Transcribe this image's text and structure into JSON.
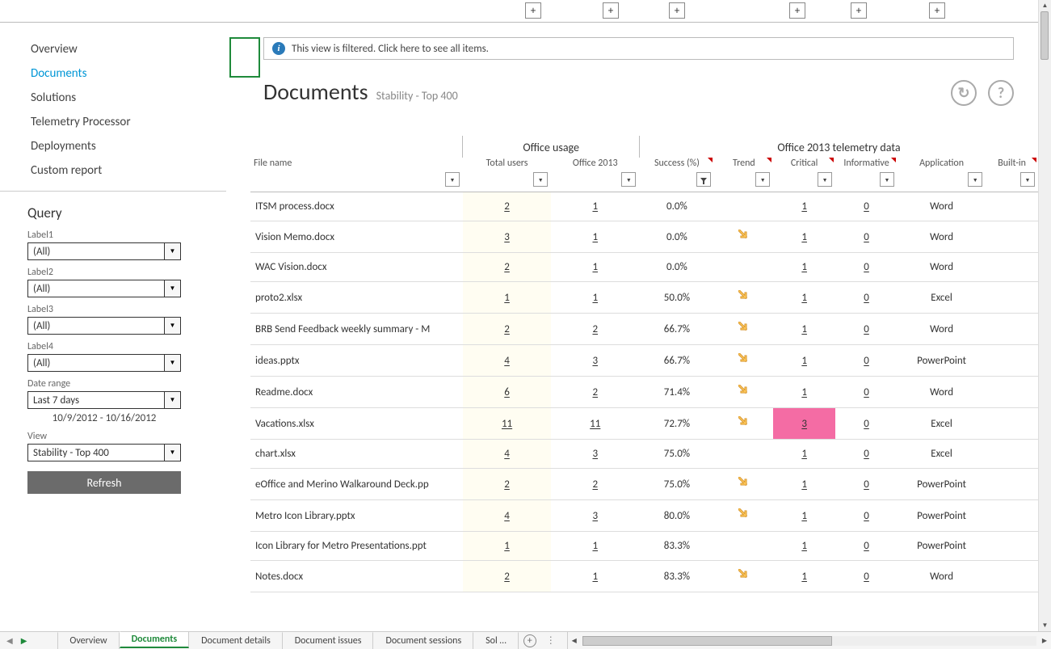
{
  "topPlusPositions": [
    650,
    746,
    828,
    977,
    1053,
    1150
  ],
  "sidebar": {
    "items": [
      {
        "label": "Overview"
      },
      {
        "label": "Documents"
      },
      {
        "label": "Solutions"
      },
      {
        "label": "Telemetry Processor"
      },
      {
        "label": "Deployments"
      },
      {
        "label": "Custom report"
      }
    ],
    "activeIndex": 1
  },
  "query": {
    "title": "Query",
    "labels": [
      "Label1",
      "Label2",
      "Label3",
      "Label4"
    ],
    "allValue": "(All)",
    "dateRangeLabel": "Date range",
    "dateRangeValue": "Last 7 days",
    "dateRangeText": "10/9/2012 - 10/16/2012",
    "viewLabel": "View",
    "viewValue": "Stability - Top 400",
    "refresh": "Refresh"
  },
  "filterBanner": "This view is filtered. Click here to see all items.",
  "page": {
    "title": "Documents",
    "subtitle": "Stability - Top 400"
  },
  "columnGroups": {
    "usage": "Office usage",
    "telemetry": "Office 2013 telemetry data"
  },
  "columns": {
    "fileName": "File name",
    "totalUsers": "Total users",
    "office2013": "Office 2013",
    "success": "Success (%)",
    "trend": "Trend",
    "critical": "Critical",
    "informative": "Informative",
    "application": "Application",
    "builtin": "Built-in"
  },
  "rows": [
    {
      "file": "ITSM process.docx",
      "users": "2",
      "o2013": "1",
      "success": "0.0%",
      "trend": false,
      "critical": "1",
      "info": "0",
      "app": "Word"
    },
    {
      "file": "Vision Memo.docx",
      "users": "3",
      "o2013": "1",
      "success": "0.0%",
      "trend": true,
      "critical": "1",
      "info": "0",
      "app": "Word"
    },
    {
      "file": "WAC Vision.docx",
      "users": "2",
      "o2013": "1",
      "success": "0.0%",
      "trend": false,
      "critical": "1",
      "info": "0",
      "app": "Word"
    },
    {
      "file": "proto2.xlsx",
      "users": "1",
      "o2013": "1",
      "success": "50.0%",
      "trend": true,
      "critical": "1",
      "info": "0",
      "app": "Excel"
    },
    {
      "file": "BRB Send Feedback weekly summary - M",
      "users": "2",
      "o2013": "2",
      "success": "66.7%",
      "trend": true,
      "critical": "1",
      "info": "0",
      "app": "Word"
    },
    {
      "file": "ideas.pptx",
      "users": "4",
      "o2013": "3",
      "success": "66.7%",
      "trend": true,
      "critical": "1",
      "info": "0",
      "app": "PowerPoint"
    },
    {
      "file": "Readme.docx",
      "users": "6",
      "o2013": "2",
      "success": "71.4%",
      "trend": true,
      "critical": "1",
      "info": "0",
      "app": "Word"
    },
    {
      "file": "Vacations.xlsx",
      "users": "11",
      "o2013": "11",
      "success": "72.7%",
      "trend": true,
      "critical": "3",
      "info": "0",
      "app": "Excel",
      "hotCritical": true
    },
    {
      "file": "chart.xlsx",
      "users": "4",
      "o2013": "3",
      "success": "75.0%",
      "trend": false,
      "critical": "1",
      "info": "0",
      "app": "Excel"
    },
    {
      "file": "eOffice and Merino Walkaround Deck.pp",
      "users": "2",
      "o2013": "2",
      "success": "75.0%",
      "trend": true,
      "critical": "1",
      "info": "0",
      "app": "PowerPoint"
    },
    {
      "file": "Metro Icon Library.pptx",
      "users": "4",
      "o2013": "3",
      "success": "80.0%",
      "trend": true,
      "critical": "1",
      "info": "0",
      "app": "PowerPoint"
    },
    {
      "file": "Icon Library for Metro Presentations.ppt",
      "users": "1",
      "o2013": "1",
      "success": "83.3%",
      "trend": false,
      "critical": "1",
      "info": "0",
      "app": "PowerPoint"
    },
    {
      "file": "Notes.docx",
      "users": "2",
      "o2013": "1",
      "success": "83.3%",
      "trend": true,
      "critical": "1",
      "info": "0",
      "app": "Word"
    }
  ],
  "worksheetTabs": [
    "Overview",
    "Documents",
    "Document details",
    "Document issues",
    "Document sessions",
    "Sol …"
  ],
  "worksheetActiveIndex": 1
}
